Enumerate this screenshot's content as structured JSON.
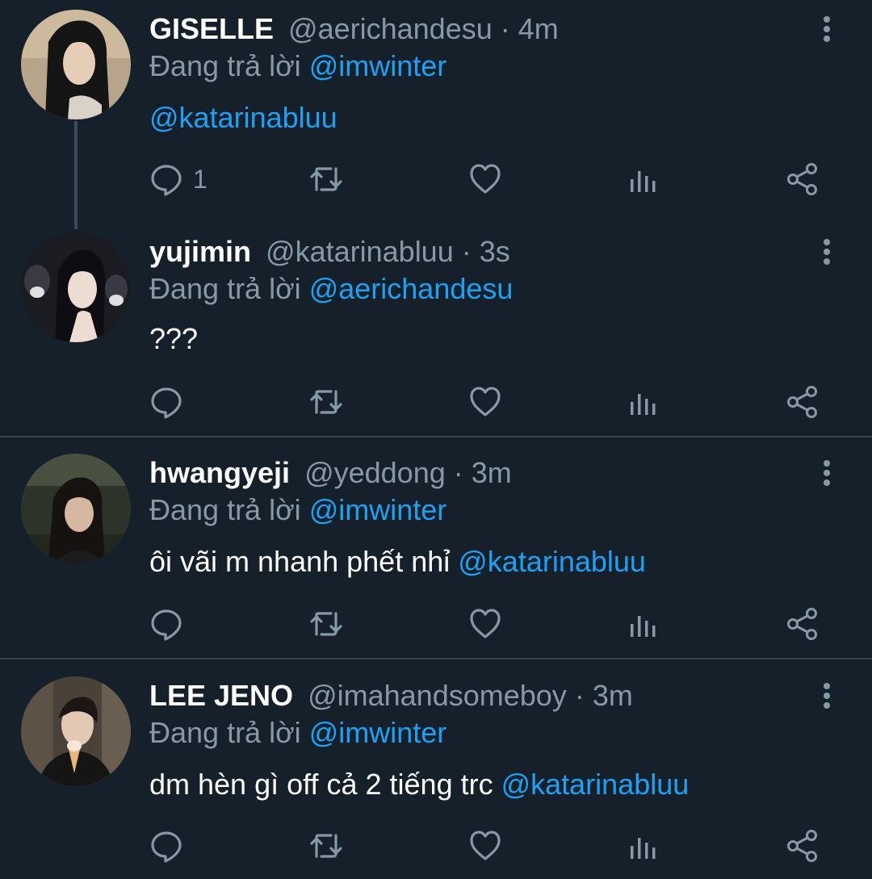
{
  "tweets": [
    {
      "name": "GISELLE",
      "handle": "@aerichandesu",
      "dot": "·",
      "time": "4m",
      "reply_prefix": "Đang trả lời",
      "reply_to": "@imwinter",
      "text": "",
      "text_mention": "@katarinabluu",
      "reply_count": "1"
    },
    {
      "name": "yujimin",
      "handle": "@katarinabluu",
      "dot": "·",
      "time": "3s",
      "reply_prefix": "Đang trả lời",
      "reply_to": "@aerichandesu",
      "text": "???",
      "text_mention": "",
      "reply_count": ""
    },
    {
      "name": "hwangyeji",
      "handle": "@yeddong",
      "dot": "·",
      "time": "3m",
      "reply_prefix": "Đang trả lời",
      "reply_to": "@imwinter",
      "text": "ôi vãi m nhanh phết nhỉ ",
      "text_mention": "@katarinabluu",
      "reply_count": ""
    },
    {
      "name": "LEE JENO",
      "handle": "@imahandsomeboy",
      "dot": "·",
      "time": "3m",
      "reply_prefix": "Đang trả lời",
      "reply_to": "@imwinter",
      "text": "dm hèn gì off cả 2 tiếng trc ",
      "text_mention": "@katarinabluu",
      "reply_count": ""
    }
  ],
  "colors": {
    "background": "#15202b",
    "mention": "#1da1f2",
    "muted": "#8899a6",
    "divider": "#38444d"
  },
  "icons": [
    "reply-icon",
    "retweet-icon",
    "like-icon",
    "analytics-icon",
    "share-icon",
    "more-options-icon"
  ]
}
